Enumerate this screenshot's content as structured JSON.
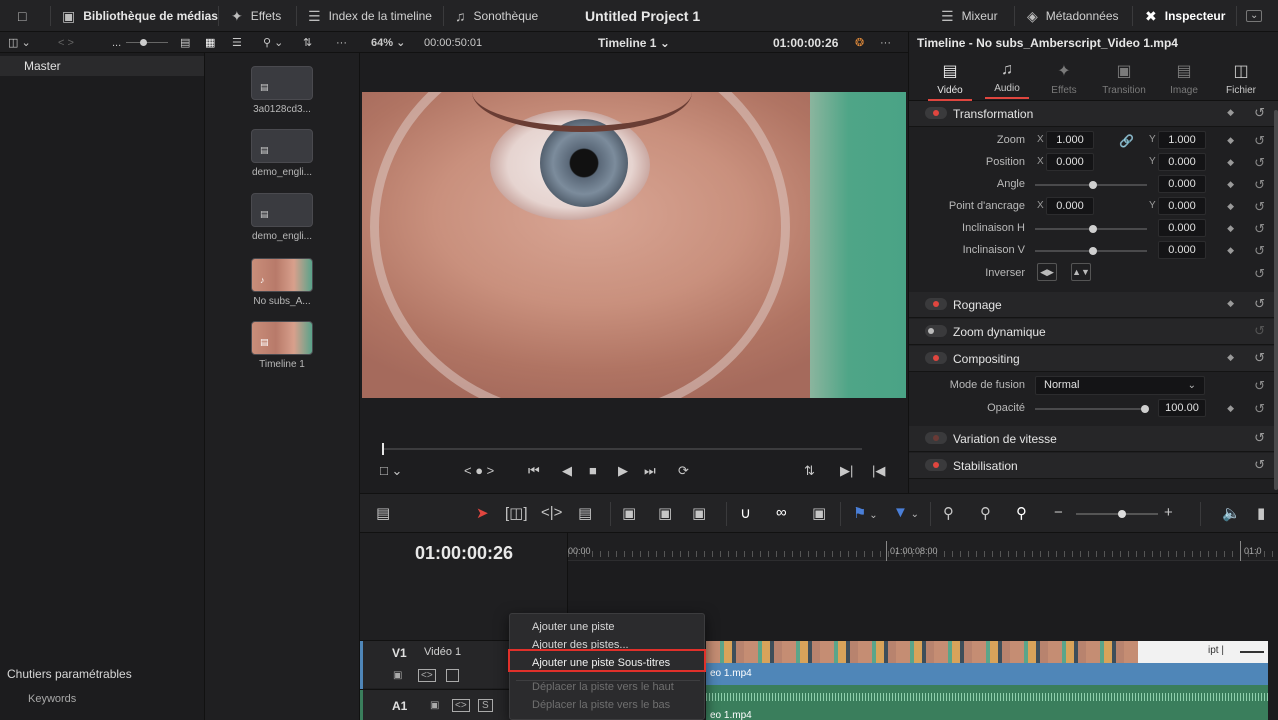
{
  "topbar": {
    "media_pool": "Bibliothèque de médias",
    "effects": "Effets",
    "edit_index": "Index de la timeline",
    "sound_library": "Sonothèque",
    "project_title": "Untitled Project 1",
    "mixer": "Mixeur",
    "metadata": "Métadonnées",
    "inspector": "Inspecteur"
  },
  "viewer_bar": {
    "zoom": "64%",
    "duration": "00:00:50:01",
    "timeline_name": "Timeline 1",
    "timecode": "01:00:00:26"
  },
  "bins": {
    "master": "Master",
    "smart_bins": "Chutiers paramétrables",
    "keywords": "Keywords"
  },
  "media_pool": {
    "clips": [
      {
        "name": "3a0128cd3...",
        "kind": "subtitle"
      },
      {
        "name": "demo_engli...",
        "kind": "subtitle"
      },
      {
        "name": "demo_engli...",
        "kind": "subtitle"
      },
      {
        "name": "No subs_A...",
        "kind": "video-audio"
      },
      {
        "name": "Timeline 1",
        "kind": "timeline"
      }
    ]
  },
  "inspector": {
    "title": "Timeline - No subs_Amberscript_Video 1.mp4",
    "tabs": [
      "Vidéo",
      "Audio",
      "Effets",
      "Transition",
      "Image",
      "Fichier"
    ],
    "active_tab": "Vidéo",
    "sections": {
      "transform": "Transformation",
      "crop": "Rognage",
      "dynamic_zoom": "Zoom dynamique",
      "compositing": "Compositing",
      "speed": "Variation de vitesse",
      "stabilization": "Stabilisation"
    },
    "fields": {
      "zoom_label": "Zoom",
      "zoom_x": "1.000",
      "zoom_y": "1.000",
      "position_label": "Position",
      "position_x": "0.000",
      "position_y": "0.000",
      "angle_label": "Angle",
      "angle": "0.000",
      "anchor_label": "Point d'ancrage",
      "anchor_x": "0.000",
      "anchor_y": "0.000",
      "pitch_label": "Inclinaison H",
      "pitch": "0.000",
      "yaw_label": "Inclinaison V",
      "yaw": "0.000",
      "flip_label": "Inverser",
      "blend_label": "Mode de fusion",
      "blend": "Normal",
      "opacity_label": "Opacité",
      "opacity": "100.00",
      "axis_x": "X",
      "axis_y": "Y"
    }
  },
  "timeline": {
    "timecode": "01:00:00:26",
    "ruler": [
      "00:00",
      "01:00:08:00",
      "01:0"
    ],
    "v1_label": "V1",
    "v1_name": "Vidéo 1",
    "a1_label": "A1",
    "video_clip": "eo 1.mp4",
    "audio_clip": "eo 1.mp4",
    "subtitle_clip": "ipt |",
    "solo": "S"
  },
  "context_menu": {
    "items": [
      {
        "label": "Ajouter une piste",
        "enabled": true
      },
      {
        "label": "Ajouter des pistes...",
        "enabled": true
      },
      {
        "label": "Ajouter une piste Sous-titres",
        "enabled": true,
        "highlighted": true
      },
      {
        "label": "Déplacer la piste vers le haut",
        "enabled": false
      },
      {
        "label": "Déplacer la piste vers le bas",
        "enabled": false
      }
    ]
  },
  "colors": {
    "accent": "#e0463f",
    "highlight_box": "#e0302a",
    "video_clip": "#4f86b8",
    "audio_clip": "#3a7e5c"
  }
}
